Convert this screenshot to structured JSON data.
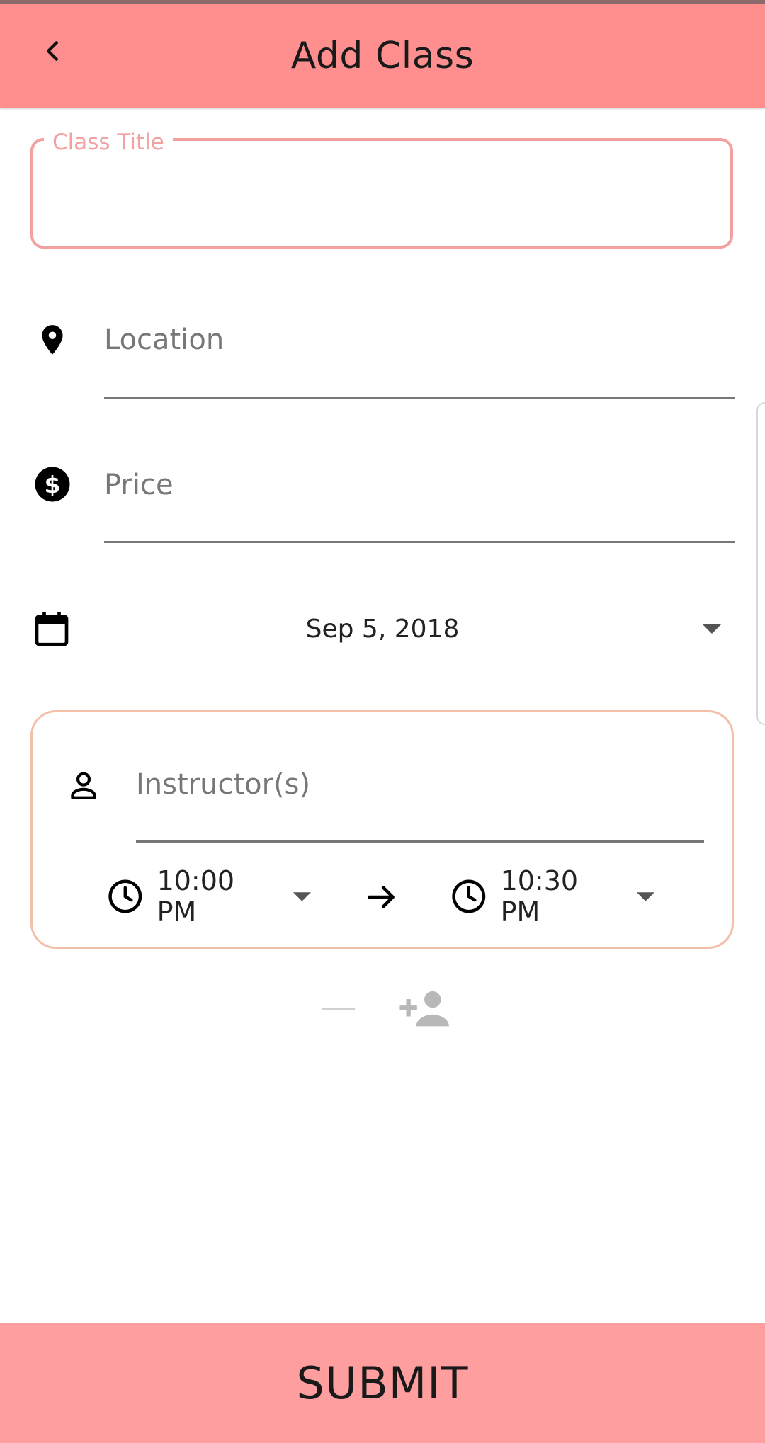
{
  "header": {
    "title": "Add Class",
    "back_icon": "chevron-left-icon",
    "color": "#ff8f8f"
  },
  "form": {
    "class_title": {
      "label": "Class Title",
      "value": ""
    },
    "location": {
      "placeholder": "Location",
      "icon": "location-pin-icon"
    },
    "price": {
      "placeholder": "Price",
      "icon": "dollar-circle-icon"
    },
    "date": {
      "value": "Sep 5, 2018",
      "icon": "calendar-icon"
    }
  },
  "instructor_card": {
    "instructor": {
      "placeholder": "Instructor(s)",
      "icon": "person-icon"
    },
    "start_time": "10:00 PM",
    "end_time": "10:30 PM"
  },
  "actions": {
    "remove_icon": "minus-icon",
    "add_person_icon": "add-person-icon"
  },
  "submit": {
    "label": "SUBMIT",
    "color": "#ff9e9e"
  }
}
